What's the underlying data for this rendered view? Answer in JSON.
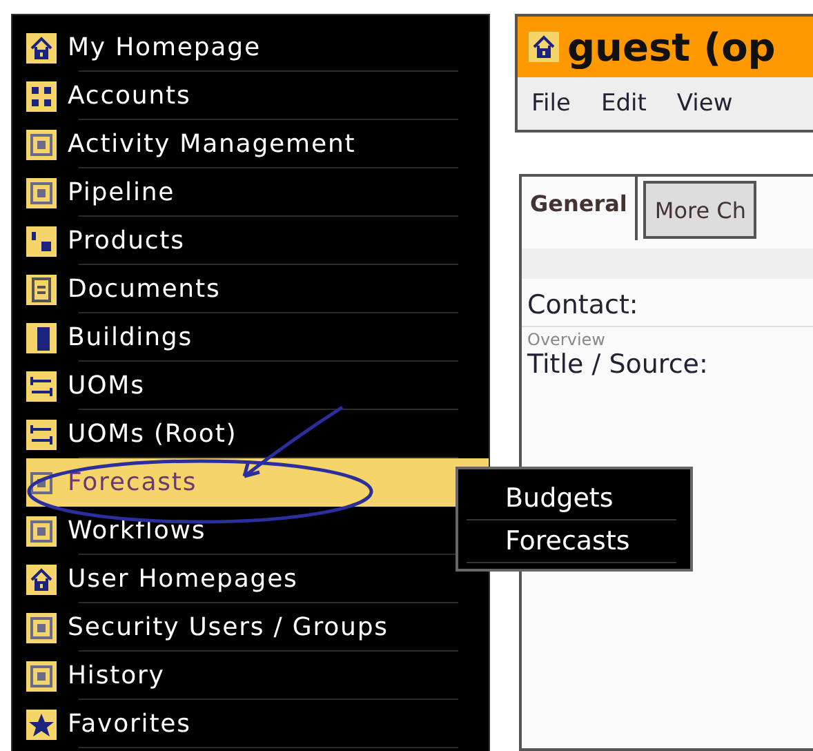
{
  "sidebar": {
    "items": [
      {
        "label": "My Homepage",
        "selected": false
      },
      {
        "label": "Accounts",
        "selected": false
      },
      {
        "label": "Activity Management",
        "selected": false
      },
      {
        "label": "Pipeline",
        "selected": false
      },
      {
        "label": "Products",
        "selected": false
      },
      {
        "label": "Documents",
        "selected": false
      },
      {
        "label": "Buildings",
        "selected": false
      },
      {
        "label": "UOMs",
        "selected": false
      },
      {
        "label": "UOMs (Root)",
        "selected": false
      },
      {
        "label": "Forecasts",
        "selected": true
      },
      {
        "label": "Workflows",
        "selected": false
      },
      {
        "label": "User Homepages",
        "selected": false
      },
      {
        "label": "Security Users / Groups",
        "selected": false
      },
      {
        "label": "History",
        "selected": false
      },
      {
        "label": "Favorites",
        "selected": false
      }
    ]
  },
  "submenu": {
    "items": [
      "Budgets",
      "Forecasts"
    ]
  },
  "window": {
    "title": "guest (op",
    "menus": [
      "File",
      "Edit",
      "View"
    ]
  },
  "tabs": [
    {
      "label": "General",
      "selected": true
    },
    {
      "label": "More Ch",
      "selected": false
    }
  ],
  "form": {
    "contact_label": "Contact:",
    "section": "Overview",
    "title_label": "Title / Source:"
  }
}
